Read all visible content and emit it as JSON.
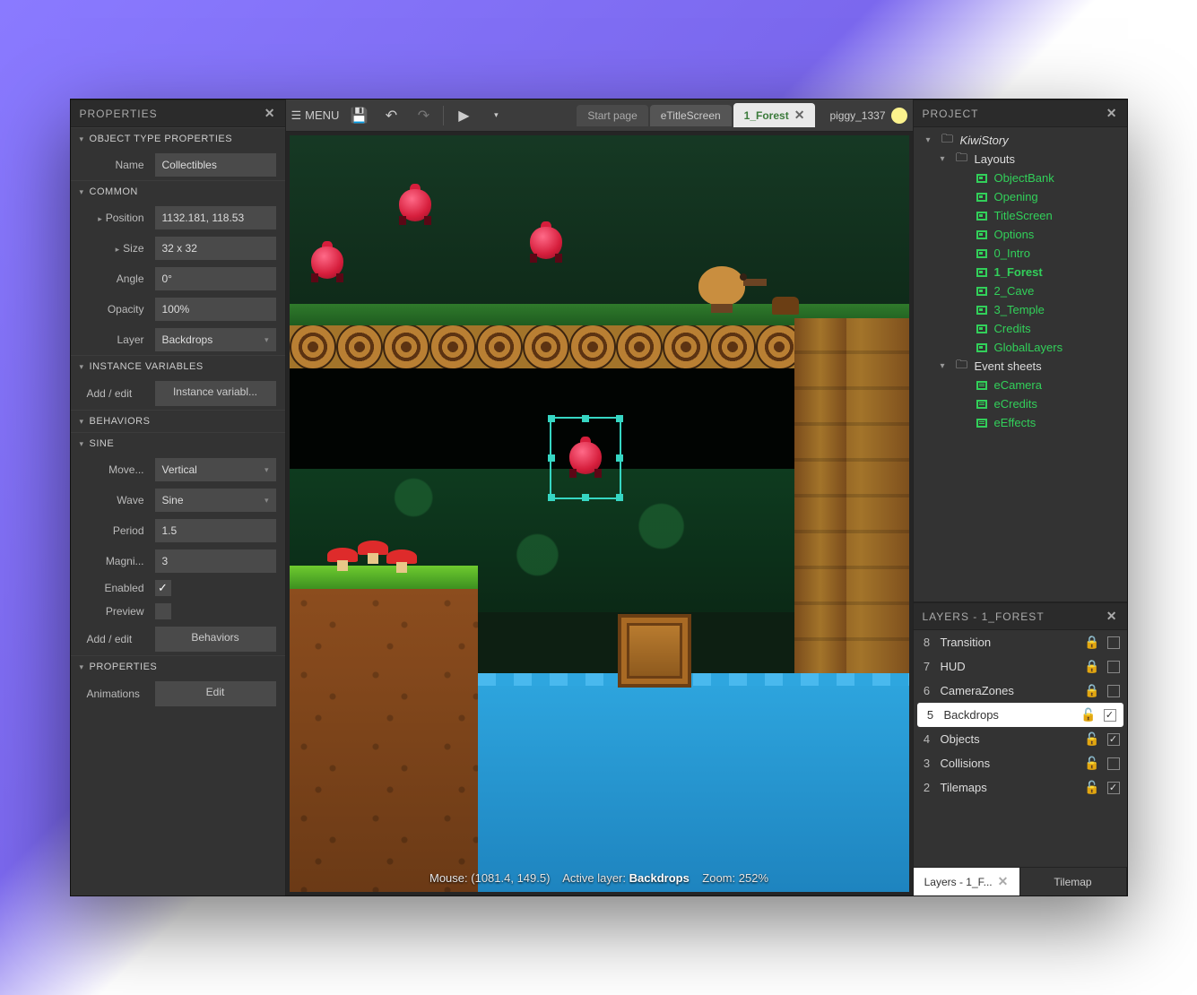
{
  "properties_panel": {
    "title": "PROPERTIES",
    "object_type_section": "OBJECT TYPE PROPERTIES",
    "name_label": "Name",
    "name_value": "Collectibles",
    "common_section": "COMMON",
    "position_label": "Position",
    "position_value": "1132.181, 118.53",
    "size_label": "Size",
    "size_value": "32 x 32",
    "angle_label": "Angle",
    "angle_value": "0°",
    "opacity_label": "Opacity",
    "opacity_value": "100%",
    "layer_label": "Layer",
    "layer_value": "Backdrops",
    "instance_vars_section": "INSTANCE VARIABLES",
    "add_edit_label": "Add / edit",
    "instance_vars_btn": "Instance variabl...",
    "behaviors_section": "BEHAVIORS",
    "sine_section": "SINE",
    "move_label": "Move...",
    "move_value": "Vertical",
    "wave_label": "Wave",
    "wave_value": "Sine",
    "period_label": "Period",
    "period_value": "1.5",
    "magnitude_label": "Magni...",
    "magnitude_value": "3",
    "enabled_label": "Enabled",
    "enabled_check": "✓",
    "preview_label": "Preview",
    "behaviors_btn": "Behaviors",
    "properties_section": "PROPERTIES",
    "animations_label": "Animations",
    "edit_btn": "Edit"
  },
  "toolbar": {
    "menu": "MENU",
    "start_page_tab": "Start page",
    "etitlescreen_tab": "eTitleScreen",
    "active_tab": "1_Forest",
    "user_name": "piggy_1337"
  },
  "status": {
    "mouse_label": "Mouse:",
    "mouse_value": "(1081.4, 149.5)",
    "active_layer_label": "Active layer:",
    "active_layer_value": "Backdrops",
    "zoom_label": "Zoom:",
    "zoom_value": "252%"
  },
  "project_panel": {
    "title": "PROJECT",
    "root": "KiwiStory",
    "layouts_folder": "Layouts",
    "layouts": [
      "ObjectBank",
      "Opening",
      "TitleScreen",
      "Options",
      "0_Intro",
      "1_Forest",
      "2_Cave",
      "3_Temple",
      "Credits",
      "GlobalLayers"
    ],
    "event_sheets_folder": "Event sheets",
    "event_sheets": [
      "eCamera",
      "eCredits",
      "eEffects"
    ]
  },
  "layers_panel": {
    "title": "LAYERS - 1_FOREST",
    "layers": [
      {
        "num": "8",
        "name": "Transition",
        "locked": true,
        "visible": false
      },
      {
        "num": "7",
        "name": "HUD",
        "locked": true,
        "visible": false
      },
      {
        "num": "6",
        "name": "CameraZones",
        "locked": true,
        "visible": false
      },
      {
        "num": "5",
        "name": "Backdrops",
        "locked": false,
        "visible": true,
        "active": true
      },
      {
        "num": "4",
        "name": "Objects",
        "locked": false,
        "visible": true
      },
      {
        "num": "3",
        "name": "Collisions",
        "locked": false,
        "visible": false
      },
      {
        "num": "2",
        "name": "Tilemaps",
        "locked": false,
        "visible": true
      }
    ],
    "tab_layers": "Layers - 1_F...",
    "tab_tilemap": "Tilemap"
  }
}
